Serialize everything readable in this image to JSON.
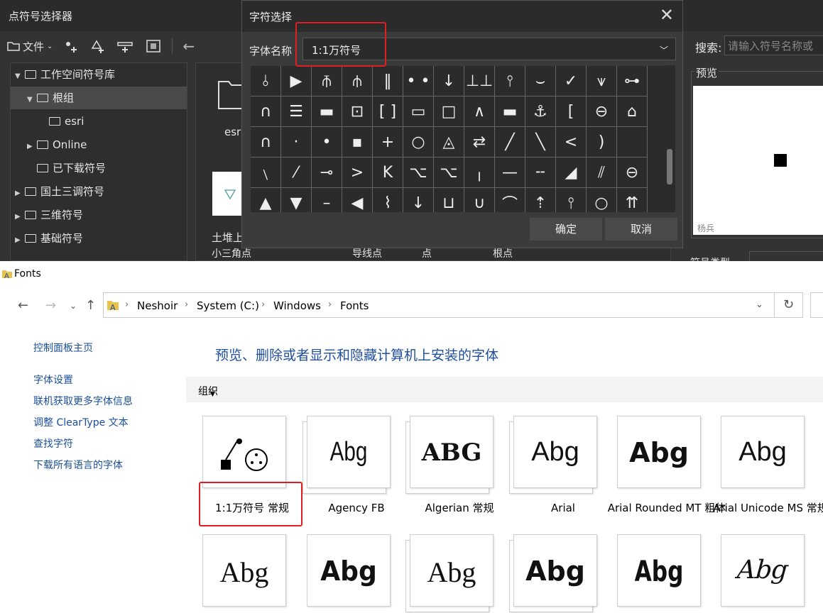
{
  "app": {
    "title": "点符号选择器",
    "toolbar": {
      "file": "文件"
    },
    "tree": [
      {
        "label": "工作空间符号库",
        "caret": "▼",
        "indent": 0,
        "selected": false
      },
      {
        "label": "根组",
        "caret": "▼",
        "indent": 1,
        "selected": true
      },
      {
        "label": "esri",
        "caret": "",
        "indent": 2,
        "selected": false
      },
      {
        "label": "Online",
        "caret": "▶",
        "indent": 1,
        "selected": false
      },
      {
        "label": "已下载符号",
        "caret": "",
        "indent": 1,
        "selected": false
      },
      {
        "label": "国土三调符号",
        "caret": "▶",
        "indent": 0,
        "selected": false
      },
      {
        "label": "三维符号",
        "caret": "▶",
        "indent": 0,
        "selected": false
      },
      {
        "label": "基础符号",
        "caret": "▶",
        "indent": 0,
        "selected": false
      }
    ],
    "mid": {
      "folder_label": "esri",
      "item_label": "土堆上",
      "bottom_labels": [
        "小三角点",
        "导线点",
        "点",
        "根点"
      ]
    },
    "right": {
      "search_label": "搜索:",
      "search_placeholder": "请输入符号名称或",
      "preview_label": "预览",
      "author": "杨兵",
      "bottom_label": "符号类型"
    }
  },
  "dialog": {
    "title": "字符选择",
    "close": "✕",
    "font_label": "字体名称",
    "font_value": "1:1万符号",
    "ok": "确定",
    "cancel": "取消",
    "glyph_rows": [
      [
        "⫰",
        "▶",
        "⫚",
        "⫛",
        "‖",
        "•  •",
        "↓",
        "⊥⊥",
        "⫯",
        "⌣",
        "✓",
        "⩛",
        "⊶"
      ],
      [
        "∩",
        "☰",
        "▬",
        "⊡",
        "[ ]",
        "▭",
        "□",
        "∧",
        "▬",
        "⚓",
        "[",
        "⊖",
        "⌂"
      ],
      [
        "∩",
        "·",
        "•",
        "▪",
        "+",
        "○",
        "◬",
        "⇄",
        "╱",
        "╲",
        "<",
        ")",
        ""
      ],
      [
        "﹨",
        "⁄",
        "⊸",
        ">",
        "K",
        "⌥",
        "⌥",
        "╷",
        "—",
        "╌",
        "◢",
        "⫽",
        "⊖"
      ],
      [
        "▲",
        "▼",
        "–",
        "◀",
        "⌇",
        "↓",
        "⊔",
        "∪",
        "⌒",
        "⇡",
        "⫯",
        "○",
        "⇈"
      ]
    ]
  },
  "fonts_window": {
    "title": "Fonts",
    "breadcrumb": [
      "Neshoir",
      "System (C:)",
      "Windows",
      "Fonts"
    ],
    "sidebar": [
      "控制面板主页",
      "字体设置",
      "联机获取更多字体信息",
      "调整 ClearType 文本",
      "查找字符",
      "下载所有语言的字体"
    ],
    "heading": "预览、删除或者显示和隐藏计算机上安装的字体",
    "organize": "组织",
    "fonts_row1": [
      {
        "name": "1:1万符号 常规",
        "sample": "",
        "family_style": "symbol"
      },
      {
        "name": "Agency FB",
        "sample": "Abg",
        "family_style": "narrow"
      },
      {
        "name": "Algerian 常规",
        "sample": "ABG",
        "family_style": "deco"
      },
      {
        "name": "Arial",
        "sample": "Abg",
        "family_style": "sans"
      },
      {
        "name": "Arial Rounded MT 粗体",
        "sample": "Abg",
        "family_style": "bold"
      },
      {
        "name": "Arial Unicode MS 常规",
        "sample": "Abg",
        "family_style": "sans"
      }
    ],
    "fonts_row2": [
      {
        "sample": "Abg",
        "family_style": "serif"
      },
      {
        "sample": "Abg",
        "family_style": "black"
      },
      {
        "sample": "Abg",
        "family_style": "serif"
      },
      {
        "sample": "Abg",
        "family_style": "bold"
      },
      {
        "sample": "Abg",
        "family_style": "condensed"
      },
      {
        "sample": "Abg",
        "family_style": "script"
      }
    ]
  }
}
